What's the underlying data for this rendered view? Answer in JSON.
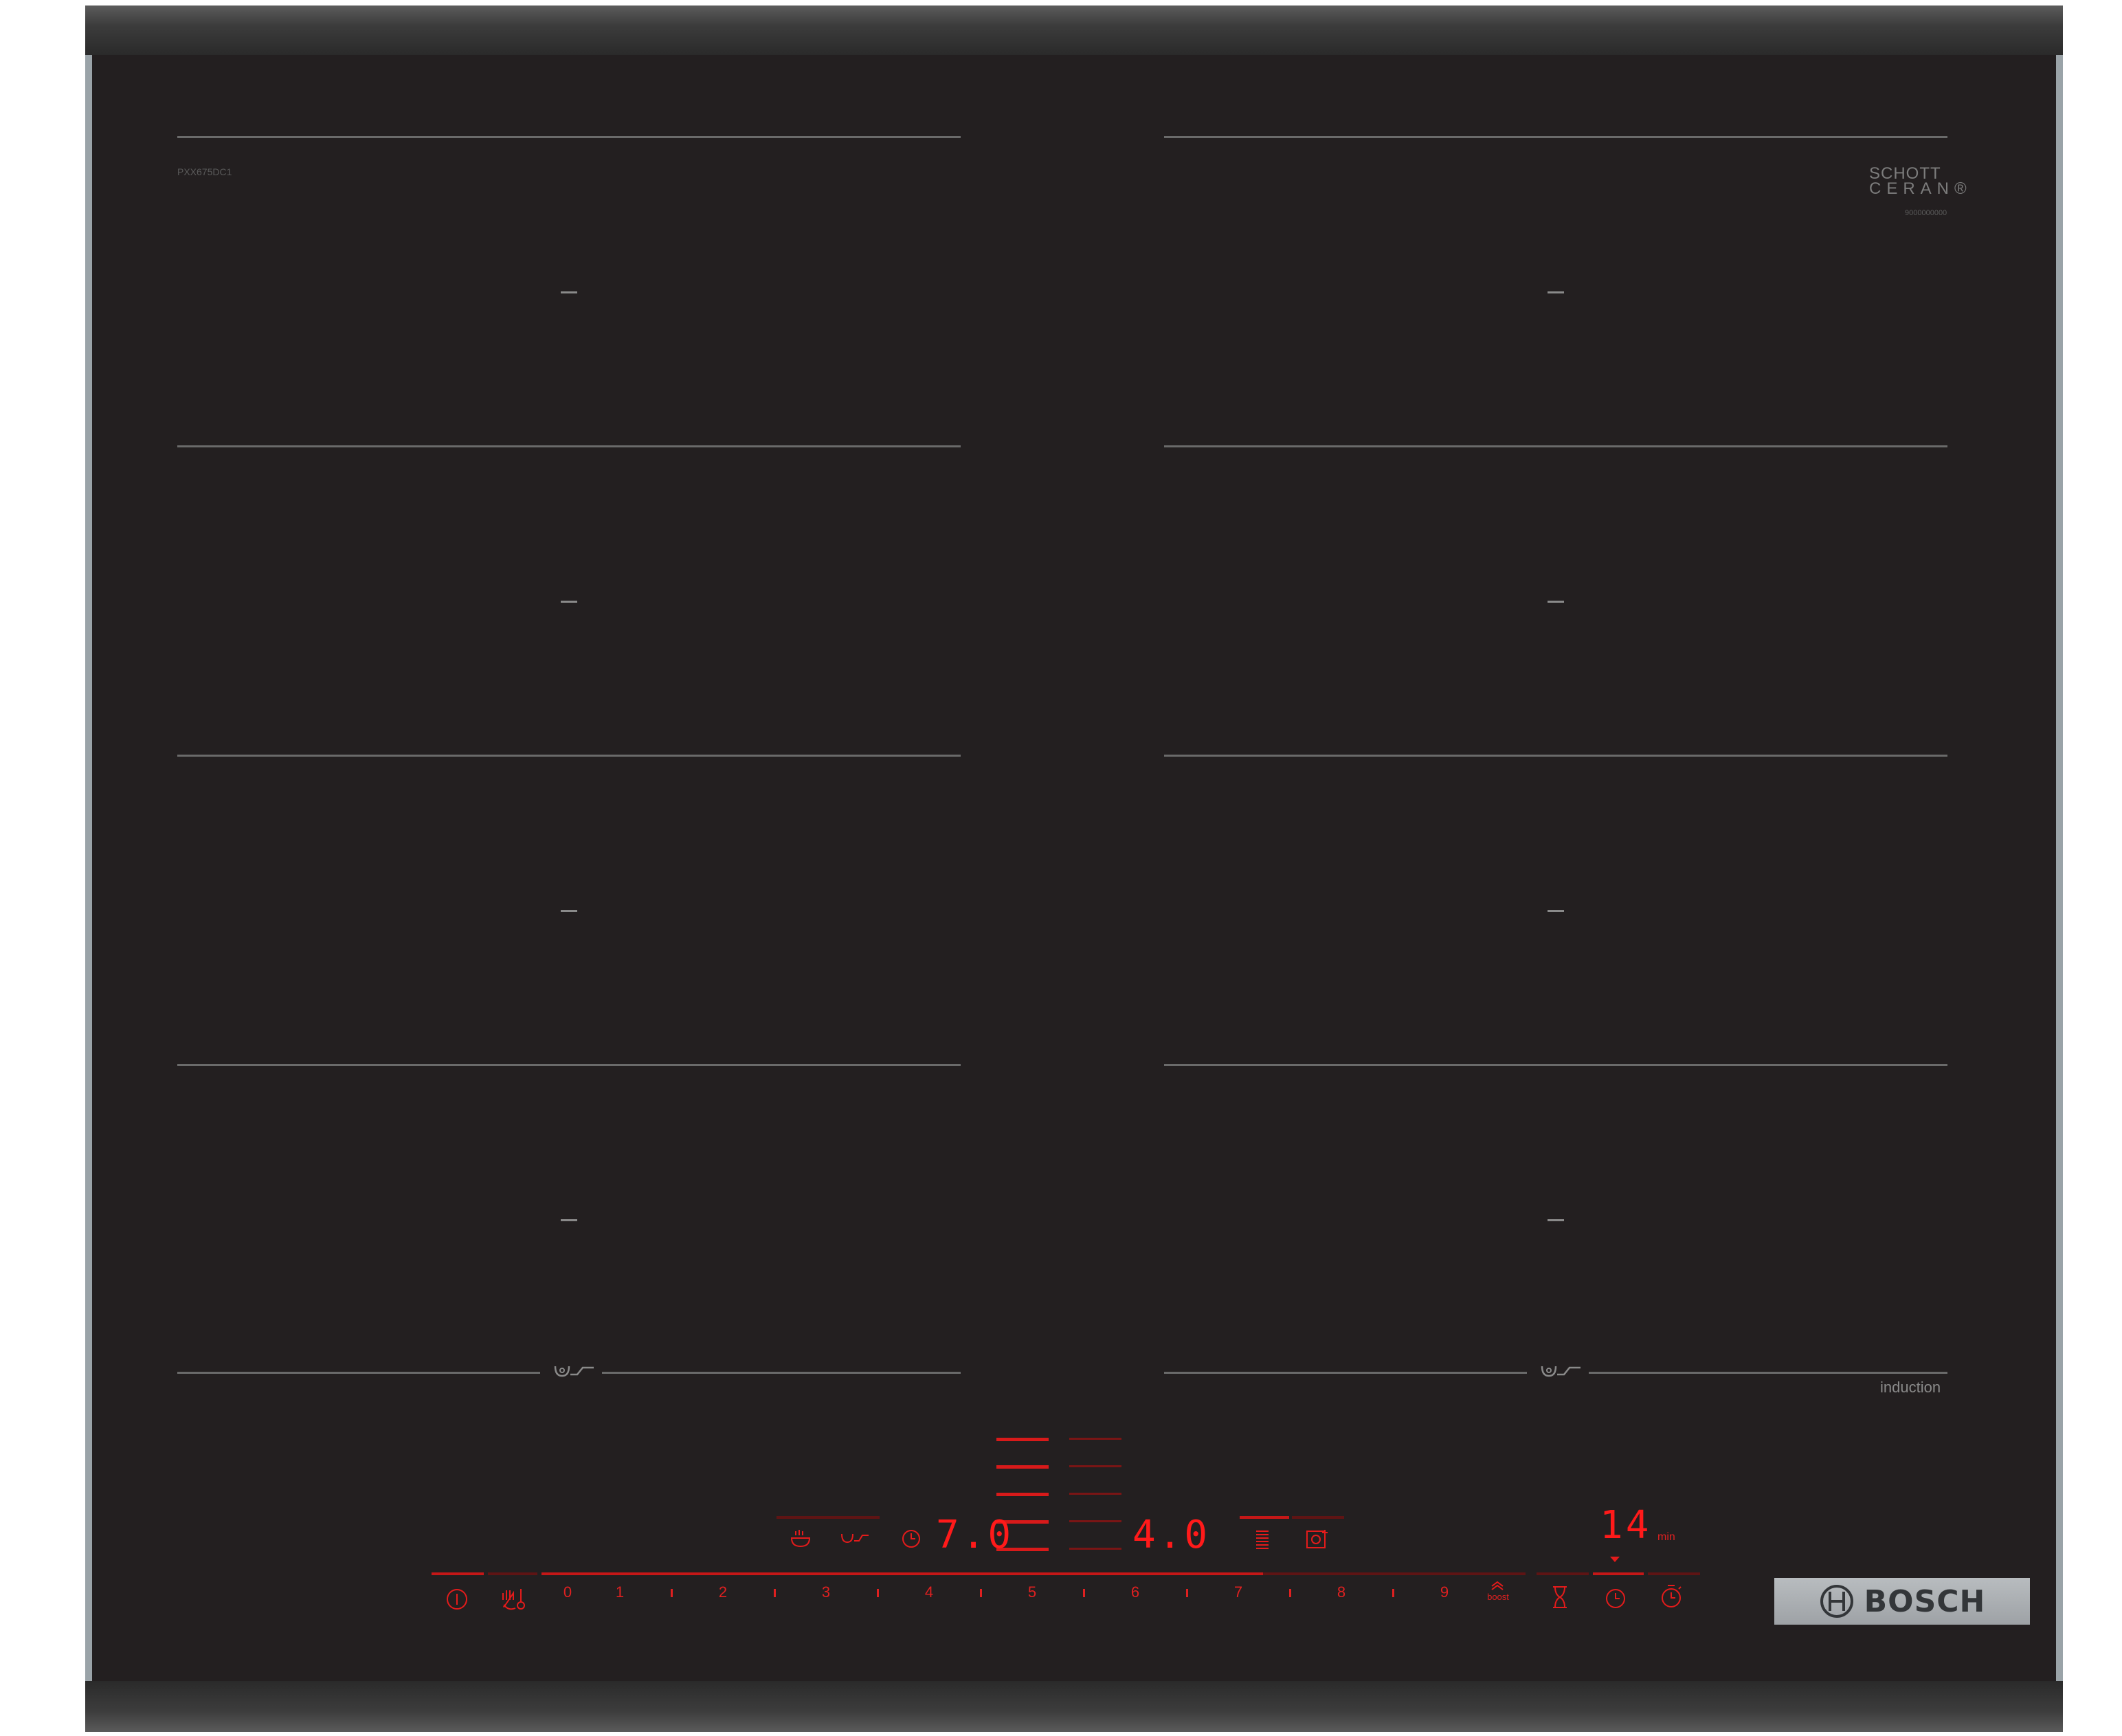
{
  "product": {
    "model": "PXX675DC1",
    "glass_brand_line1": "SCHOTT",
    "glass_brand_line2": "CERAN®",
    "glass_code": "9000000000",
    "technology": "induction",
    "brand": "BOSCH"
  },
  "zones": {
    "left_column_lines": 5,
    "right_column_lines": 5
  },
  "controls": {
    "power_icon": "info-power-icon",
    "child_lock_icon": "hand-thermometer-icon",
    "slider_labels": [
      "0",
      "1",
      "2",
      "3",
      "4",
      "5",
      "6",
      "7",
      "8",
      "9"
    ],
    "boost_label": "boost",
    "left_display_value": "7.0",
    "right_display_value": "4.0",
    "timer_display_value": "14",
    "timer_unit": "min",
    "function_icons_left": [
      "frying-sensor-icon",
      "pan-icon",
      "timer-icon"
    ],
    "function_icons_right": [
      "power-level-icon",
      "cooking-sensor-icon"
    ],
    "timer_icons": [
      "hourglass-icon",
      "clock-icon",
      "stopwatch-icon"
    ],
    "accent_color": "#e41b1b"
  }
}
